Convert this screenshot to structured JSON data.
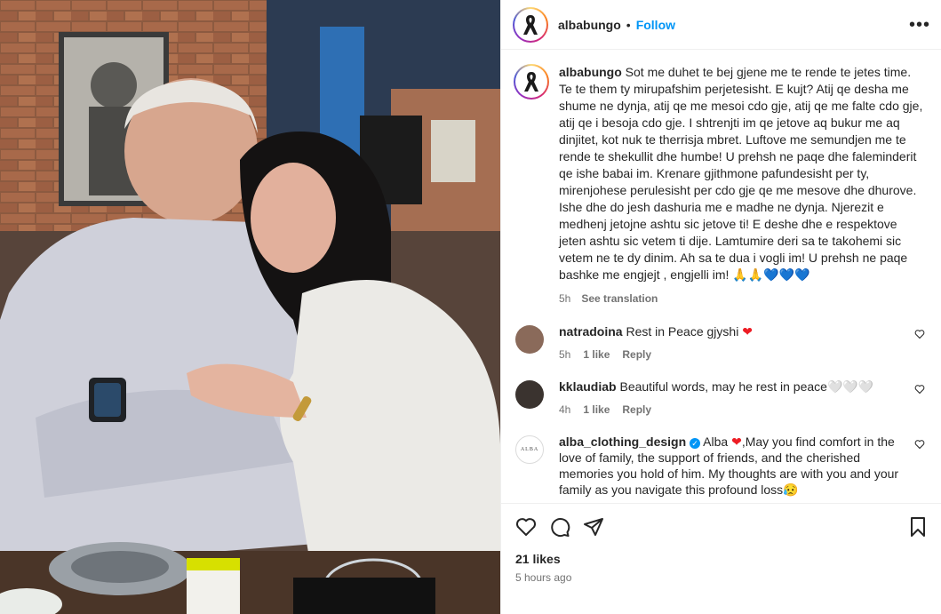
{
  "post": {
    "username": "albabungo",
    "follow_label": "Follow",
    "more_label": "•••",
    "caption": "Sot me duhet te bej gjene me te rende te jetes time. Te te them ty mirupafshim perjetesisht. E kujt? Atij qe desha me shume ne dynja, atij qe me mesoi cdo gje, atij qe me falte cdo gje, atij qe i besoja cdo gje. I shtrenjti im qe jetove aq bukur me aq dinjitet, kot nuk te therrisja mbret. Luftove me semundjen me te rende te shekullit dhe humbe! U prehsh ne paqe dhe faleminderit qe ishe babai im. Krenare gjithmone pafundesisht per ty, mirenjohese perulesisht per cdo gje qe me mesove dhe dhurove. Ishe dhe do jesh dashuria me e madhe ne dynja. Njerezit e medhenj jetojne ashtu sic jetove ti! E deshe dhe e respektove jeten ashtu sic vetem ti dije. Lamtumire deri sa te takohemi sic vetem ne te dy dinim. Ah sa te dua i vogli im! U prehsh ne paqe bashke me engjejt , engjelli im!",
    "caption_emojis": "🙏🙏💙💙💙",
    "time": "5h",
    "see_translation": "See translation",
    "likes": "21 likes",
    "time_ago": "5 hours ago"
  },
  "comments": [
    {
      "username": "natradoina",
      "text": "Rest in Peace gjyshi",
      "emoji": "❤",
      "time": "5h",
      "likes": "1 like",
      "reply": "Reply",
      "avatar_color": "#8a6a5a"
    },
    {
      "username": "kklaudiab",
      "text": "Beautiful words, may he rest in peace",
      "emoji": "🤍🤍🤍",
      "time": "4h",
      "likes": "1 like",
      "reply": "Reply",
      "avatar_color": "#3a332f"
    },
    {
      "username": "alba_clothing_design",
      "text_before": "Alba",
      "emoji": "❤",
      "text_after": ",May you find comfort in the love of family, the support of friends, and the cherished memories you hold of him. My thoughts are with you and your family as you navigate this profound loss",
      "end_emoji": "😥",
      "avatar_text": "ALBA"
    }
  ],
  "icons": [
    "heart-icon",
    "comment-icon",
    "share-icon",
    "bookmark-icon"
  ],
  "colors": {
    "accent": "#0095f6",
    "muted": "#737373",
    "heart": "#ed1c24"
  }
}
